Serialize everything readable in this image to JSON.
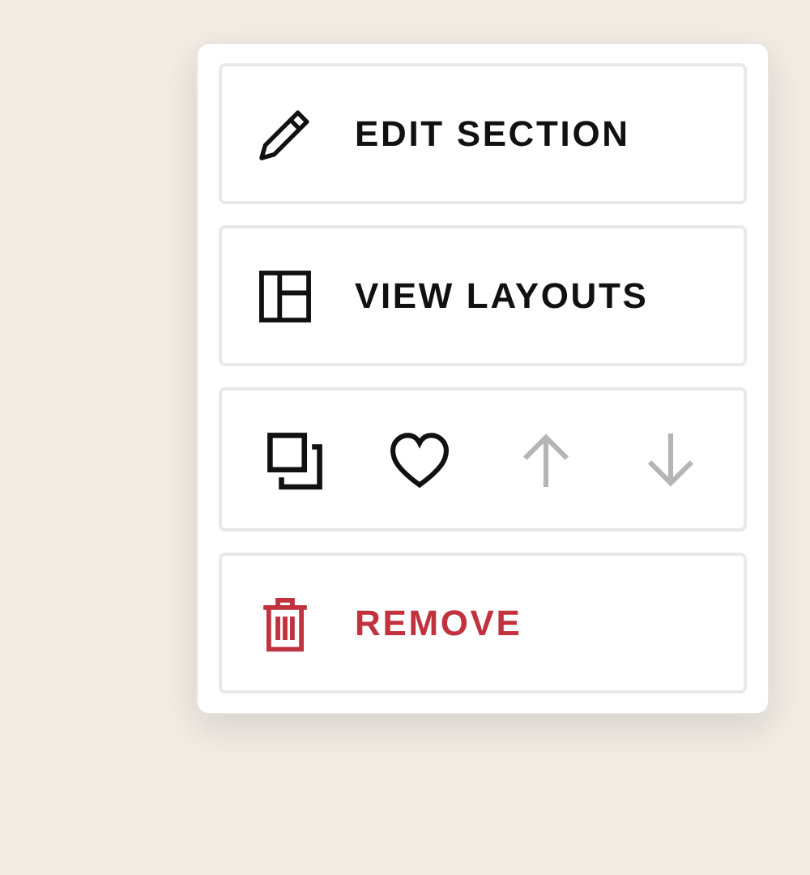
{
  "menu": {
    "items": [
      {
        "kind": "edit",
        "label": "EDIT SECTION"
      },
      {
        "kind": "layouts",
        "label": "VIEW LAYOUTS"
      },
      {
        "kind": "actions",
        "actions": [
          {
            "kind": "duplicate",
            "disabled": false
          },
          {
            "kind": "favorite",
            "disabled": false
          },
          {
            "kind": "move-up",
            "disabled": true
          },
          {
            "kind": "move-down",
            "disabled": true
          }
        ]
      },
      {
        "kind": "remove",
        "label": "REMOVE"
      }
    ]
  }
}
